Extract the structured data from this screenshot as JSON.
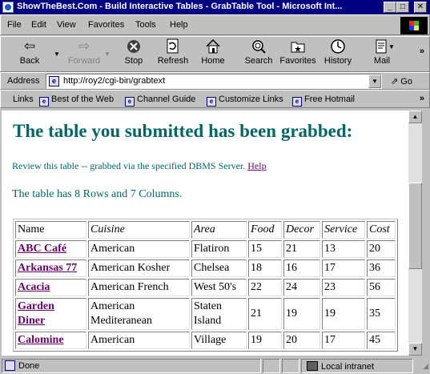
{
  "window": {
    "title": "ShowTheBest.Com - Build Interactive Tables - GrabTable Tool - Microsoft Int...",
    "minimize": "_",
    "maximize": "□",
    "close": "✕"
  },
  "menu": {
    "items": [
      "File",
      "Edit",
      "View",
      "Favorites",
      "Tools",
      "Help"
    ]
  },
  "toolbar": {
    "buttons": [
      {
        "label": "Back",
        "icon": "back-arrow-icon"
      },
      {
        "label": "Forward",
        "icon": "forward-arrow-icon"
      },
      {
        "label": "Stop",
        "icon": "stop-icon"
      },
      {
        "label": "Refresh",
        "icon": "refresh-icon"
      },
      {
        "label": "Home",
        "icon": "home-icon"
      },
      {
        "label": "Search",
        "icon": "search-icon"
      },
      {
        "label": "Favorites",
        "icon": "favorites-icon"
      },
      {
        "label": "History",
        "icon": "history-icon"
      },
      {
        "label": "Mail",
        "icon": "mail-icon"
      }
    ]
  },
  "address": {
    "label": "Address",
    "url": "http://roy2/cgi-bin/grabtext",
    "go": "Go"
  },
  "links": {
    "label": "Links",
    "items": [
      "Best of the Web",
      "Channel Guide",
      "Customize Links",
      "Free Hotmail"
    ]
  },
  "page": {
    "heading": "The table you submitted has been grabbed:",
    "review_text": "Review this table -- grabbed via the specified DBMS Server.",
    "help_link": "Help",
    "summary": "The table has 8 Rows and 7 Columns.",
    "table": {
      "headers": [
        "Name",
        "Cuisine",
        "Area",
        "Food",
        "Decor",
        "Service",
        "Cost"
      ],
      "rows": [
        [
          "ABC Café",
          "American",
          "Flatiron",
          "15",
          "21",
          "13",
          "20"
        ],
        [
          "Arkansas 77",
          "American Kosher",
          "Chelsea",
          "18",
          "16",
          "17",
          "36"
        ],
        [
          "Acacia",
          "American French",
          "West 50's",
          "22",
          "24",
          "23",
          "56"
        ],
        [
          "Garden Diner",
          "American Mediteranean",
          "Staten Island",
          "21",
          "19",
          "19",
          "35"
        ],
        [
          "Calomine",
          "American",
          "Village",
          "19",
          "20",
          "17",
          "45"
        ]
      ]
    }
  },
  "status": {
    "text": "Done",
    "zone": "Local intranet"
  },
  "colors": {
    "titlebar": "#000080",
    "heading": "#006666",
    "link": "#660066"
  }
}
